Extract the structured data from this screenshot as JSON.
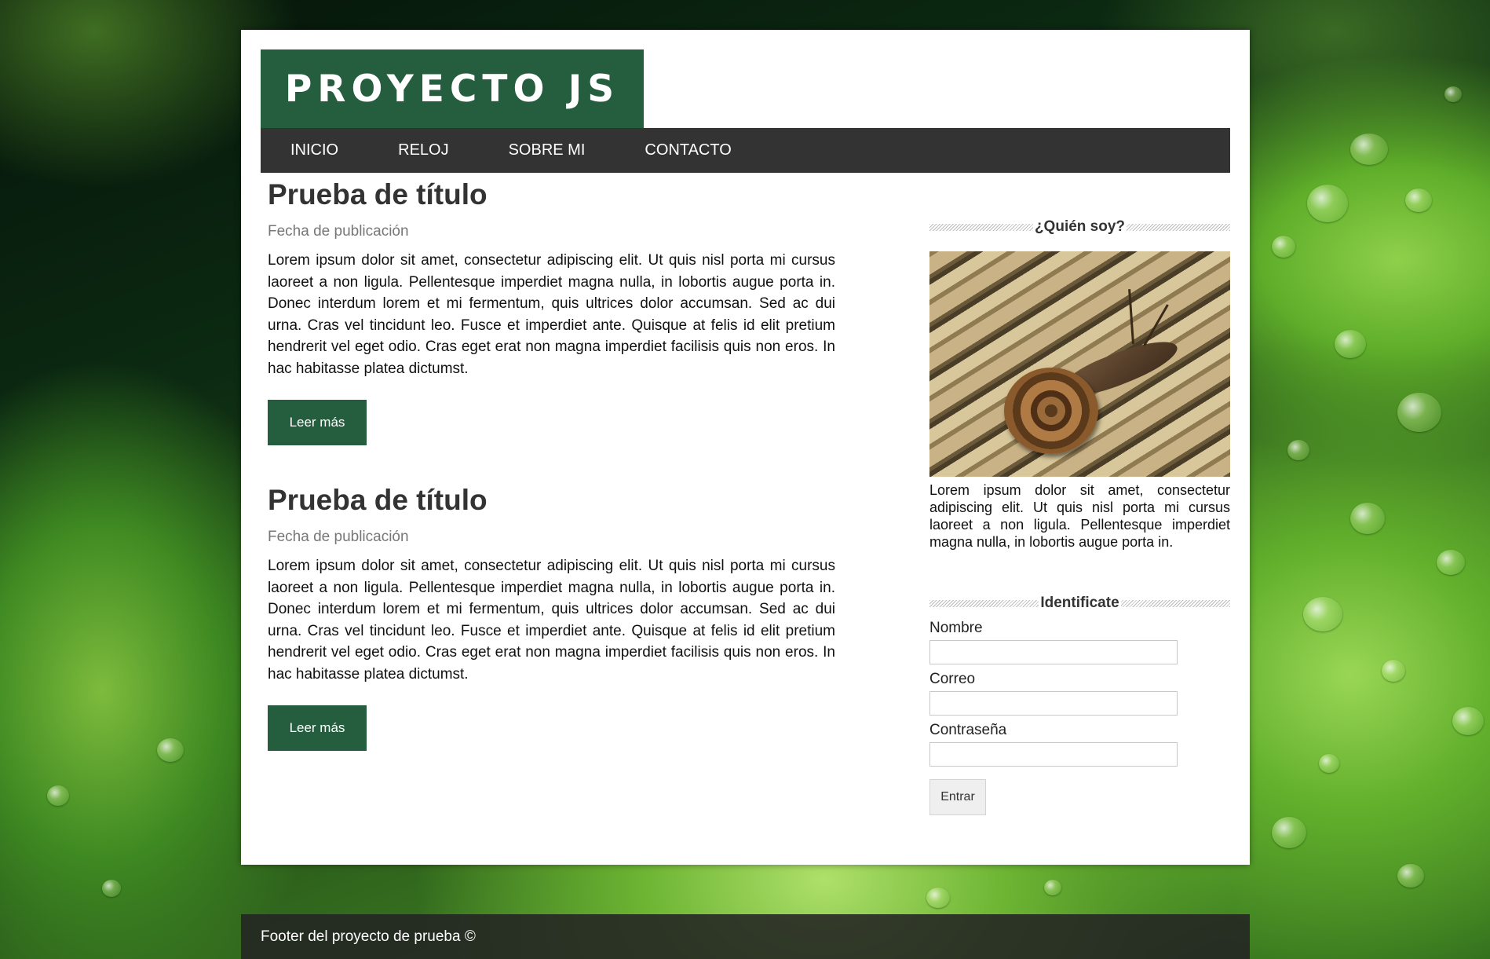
{
  "header": {
    "logo_text": "PROYECTO JS"
  },
  "nav": {
    "items": [
      {
        "label": "INICIO"
      },
      {
        "label": "RELOJ"
      },
      {
        "label": "SOBRE MI"
      },
      {
        "label": "CONTACTO"
      }
    ]
  },
  "articles": [
    {
      "title": "Prueba de título",
      "date": "Fecha de publicación",
      "body": "Lorem ipsum dolor sit amet, consectetur adipiscing elit. Ut quis nisl porta mi cursus laoreet a non ligula. Pellentesque imperdiet magna nulla, in lobortis augue porta in. Donec interdum lorem et mi fermentum, quis ultrices dolor accumsan. Sed ac dui urna. Cras vel tincidunt leo. Fusce et imperdiet ante. Quisque at felis id elit pretium hendrerit vel eget odio. Cras eget erat non magna imperdiet facilisis quis non eros. In hac habitasse platea dictumst.",
      "button": "Leer más"
    },
    {
      "title": "Prueba de título",
      "date": "Fecha de publicación",
      "body": "Lorem ipsum dolor sit amet, consectetur adipiscing elit. Ut quis nisl porta mi cursus laoreet a non ligula. Pellentesque imperdiet magna nulla, in lobortis augue porta in. Donec interdum lorem et mi fermentum, quis ultrices dolor accumsan. Sed ac dui urna. Cras vel tincidunt leo. Fusce et imperdiet ante. Quisque at felis id elit pretium hendrerit vel eget odio. Cras eget erat non magna imperdiet facilisis quis non eros. In hac habitasse platea dictumst.",
      "button": "Leer más"
    }
  ],
  "sidebar": {
    "about": {
      "heading": "¿Quién soy?",
      "text": "Lorem ipsum dolor sit amet, consectetur adipiscing elit. Ut quis nisl porta mi cursus laoreet a non ligula. Pellentesque imperdiet magna nulla, in lobortis augue porta in."
    },
    "login": {
      "heading": "Identificate",
      "name_label": "Nombre",
      "name_value": "",
      "email_label": "Correo",
      "email_value": "",
      "password_label": "Contraseña",
      "password_value": "",
      "submit_label": "Entrar"
    }
  },
  "footer": {
    "text": "Footer del proyecto de prueba ©"
  },
  "colors": {
    "brand_green": "#245e3e",
    "nav_background": "#333333",
    "footer_background": "#232323"
  }
}
